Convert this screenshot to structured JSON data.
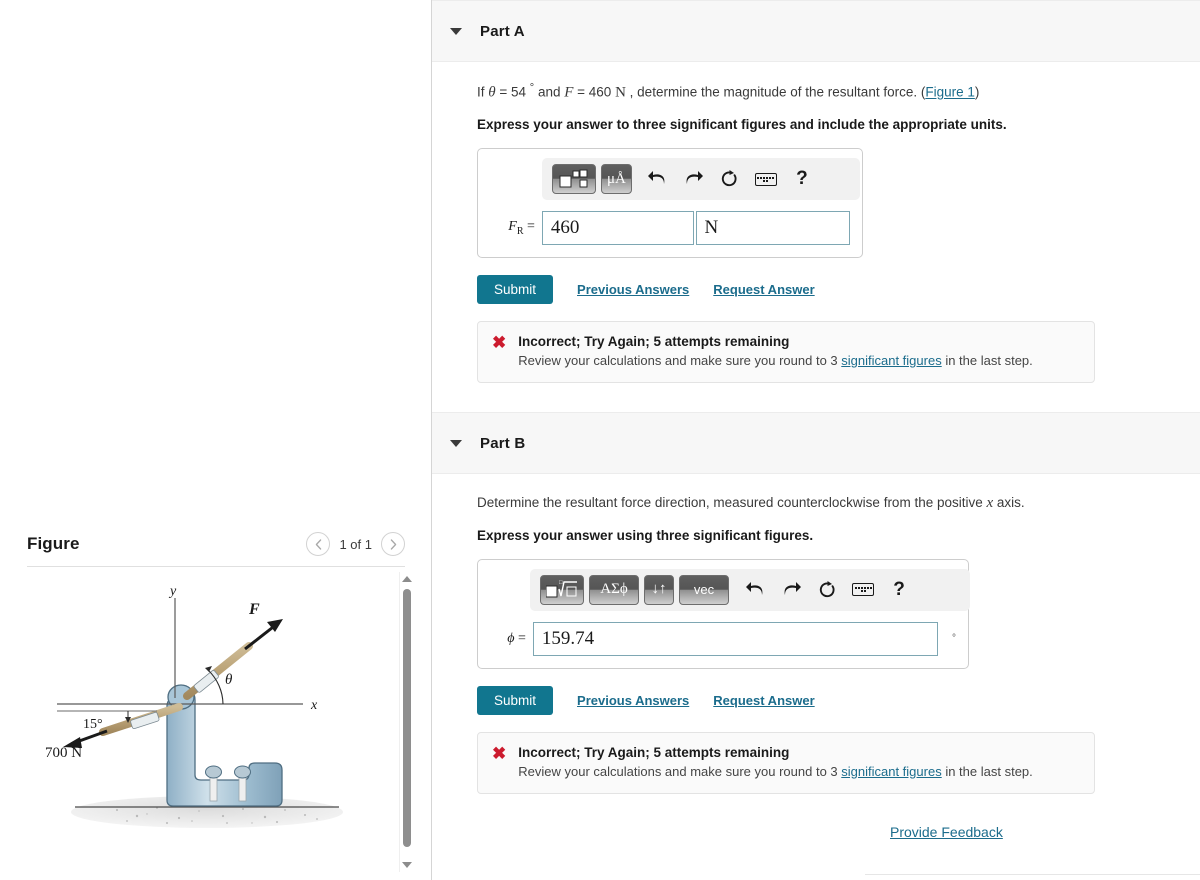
{
  "figure_panel": {
    "title": "Figure",
    "counter": "1 of 1",
    "prev_icon": "chevron-left-icon",
    "next_icon": "chevron-right-icon",
    "diagram": {
      "axis_x_label": "x",
      "axis_y_label": "y",
      "force_label": "F",
      "angle_theta": "θ",
      "angle_15": "15°",
      "force_700": "700 N"
    }
  },
  "parts": [
    {
      "id": "part-a",
      "title": "Part A",
      "caret_icon": "caret-down-icon",
      "question": {
        "pre": "If ",
        "sym_theta": "θ",
        "eq1": " = 54 ",
        "deg": "°",
        "mid": " and ",
        "sym_f": "F",
        "eq2": " = 460 ",
        "unit": "N",
        "post": " , determine the magnitude of the resultant force. (",
        "link": "Figure 1",
        "post2": ")"
      },
      "instruction": "Express your answer to three significant figures and include the appropriate units.",
      "toolbar": {
        "buttons": [
          {
            "name": "template-boxes-button",
            "label": ""
          },
          {
            "name": "units-button",
            "label": "μÅ"
          }
        ],
        "undo_icon": "undo-arrow-icon",
        "redo_icon": "redo-arrow-icon",
        "reset_icon": "reset-circular-arrow-icon",
        "keyboard_icon": "keyboard-icon",
        "help_icon": "question-mark-icon"
      },
      "answer": {
        "var_label": "F",
        "var_sub": "R",
        "equals": "=",
        "value": "460",
        "units_value": "N"
      },
      "submit_label": "Submit",
      "previous_answers_label": "Previous Answers",
      "request_answer_label": "Request Answer",
      "feedback": {
        "icon": "x-mark-icon",
        "title": "Incorrect; Try Again; 5 attempts remaining",
        "sub_pre": "Review your calculations and make sure you round to 3 ",
        "sub_link": "significant figures",
        "sub_post": " in the last step."
      }
    },
    {
      "id": "part-b",
      "title": "Part B",
      "caret_icon": "caret-down-icon",
      "question_text": "Determine the resultant force direction, measured counterclockwise from the positive ",
      "question_var": "x",
      "question_tail": " axis.",
      "instruction": "Express your answer using three significant figures.",
      "toolbar": {
        "buttons": [
          {
            "name": "template-radical-button",
            "label": ""
          },
          {
            "name": "greek-letters-button",
            "label": "ΑΣϕ"
          },
          {
            "name": "arrows-button",
            "label": "↓↑"
          },
          {
            "name": "vector-button",
            "label": "vec"
          }
        ],
        "undo_icon": "undo-arrow-icon",
        "redo_icon": "redo-arrow-icon",
        "reset_icon": "reset-circular-arrow-icon",
        "keyboard_icon": "keyboard-icon",
        "help_icon": "question-mark-icon"
      },
      "answer": {
        "var_label": "ϕ",
        "equals": "=",
        "value": "159.74",
        "degree_mark": "°"
      },
      "submit_label": "Submit",
      "previous_answers_label": "Previous Answers",
      "request_answer_label": "Request Answer",
      "feedback": {
        "icon": "x-mark-icon",
        "title": "Incorrect; Try Again; 5 attempts remaining",
        "sub_pre": "Review your calculations and make sure you round to 3 ",
        "sub_link": "significant figures",
        "sub_post": " in the last step."
      }
    }
  ],
  "provide_feedback_label": "Provide Feedback",
  "colors": {
    "accent": "#11768f",
    "link": "#1b6c8c",
    "error": "#cc1b2e",
    "header_band": "#f7f7f7",
    "field_border": "#7ea7b3"
  }
}
